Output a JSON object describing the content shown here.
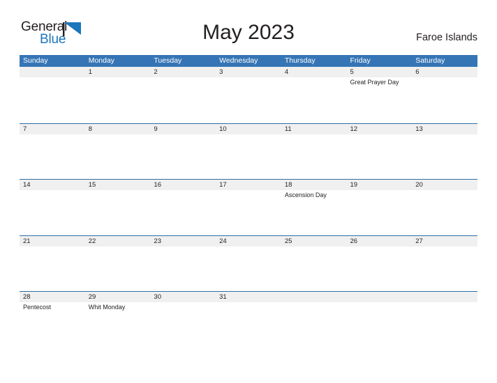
{
  "brand": {
    "name_part1": "General",
    "name_part2": "Blue",
    "flag_icon": "blue-triangle-flag-icon",
    "accent_color": "#1b75bb"
  },
  "header": {
    "title": "May 2023",
    "country": "Faroe Islands"
  },
  "colors": {
    "header_blue": "#3575b5",
    "row_line_blue": "#2e6da4",
    "date_band_gray": "#f0f0f0",
    "text": "#231f20"
  },
  "calendar": {
    "month": "May",
    "year": "2023",
    "weekday_headers": [
      "Sunday",
      "Monday",
      "Tuesday",
      "Wednesday",
      "Thursday",
      "Friday",
      "Saturday"
    ],
    "weeks": [
      [
        {
          "day": "",
          "event": ""
        },
        {
          "day": "1",
          "event": ""
        },
        {
          "day": "2",
          "event": ""
        },
        {
          "day": "3",
          "event": ""
        },
        {
          "day": "4",
          "event": ""
        },
        {
          "day": "5",
          "event": "Great Prayer Day"
        },
        {
          "day": "6",
          "event": ""
        }
      ],
      [
        {
          "day": "7",
          "event": ""
        },
        {
          "day": "8",
          "event": ""
        },
        {
          "day": "9",
          "event": ""
        },
        {
          "day": "10",
          "event": ""
        },
        {
          "day": "11",
          "event": ""
        },
        {
          "day": "12",
          "event": ""
        },
        {
          "day": "13",
          "event": ""
        }
      ],
      [
        {
          "day": "14",
          "event": ""
        },
        {
          "day": "15",
          "event": ""
        },
        {
          "day": "16",
          "event": ""
        },
        {
          "day": "17",
          "event": ""
        },
        {
          "day": "18",
          "event": "Ascension Day"
        },
        {
          "day": "19",
          "event": ""
        },
        {
          "day": "20",
          "event": ""
        }
      ],
      [
        {
          "day": "21",
          "event": ""
        },
        {
          "day": "22",
          "event": ""
        },
        {
          "day": "23",
          "event": ""
        },
        {
          "day": "24",
          "event": ""
        },
        {
          "day": "25",
          "event": ""
        },
        {
          "day": "26",
          "event": ""
        },
        {
          "day": "27",
          "event": ""
        }
      ],
      [
        {
          "day": "28",
          "event": "Pentecost"
        },
        {
          "day": "29",
          "event": "Whit Monday"
        },
        {
          "day": "30",
          "event": ""
        },
        {
          "day": "31",
          "event": ""
        },
        {
          "day": "",
          "event": ""
        },
        {
          "day": "",
          "event": ""
        },
        {
          "day": "",
          "event": ""
        }
      ]
    ]
  }
}
